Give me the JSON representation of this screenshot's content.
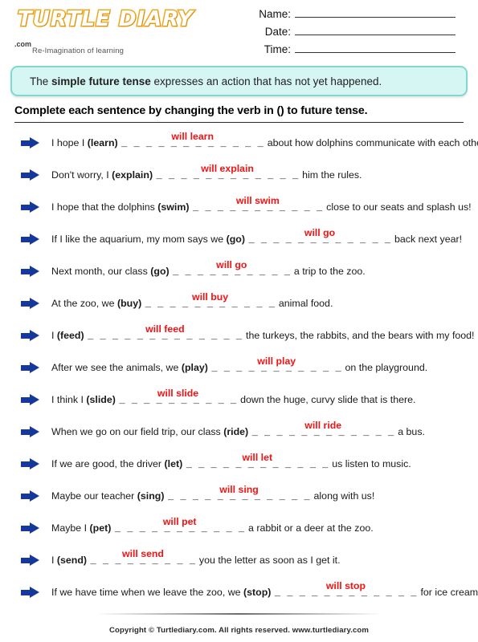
{
  "header": {
    "logo": {
      "word": "TURTLE DIARY",
      "dotcom": ".com",
      "tagline": "Re-Imagination of learning"
    },
    "fields": [
      {
        "label": "Name:"
      },
      {
        "label": "Date:"
      },
      {
        "label": "Time:"
      }
    ]
  },
  "info": {
    "prefix": "The ",
    "bold": "simple future tense",
    "suffix": " expresses an action that has not yet happened."
  },
  "instruction": "Complete each sentence by changing the verb in () to future tense.",
  "questions": [
    {
      "before": "I hope I ",
      "verb": "(learn)",
      "dashes": "_ _ _ _ _ _ _ _ _ _ _ _",
      "answer": "will learn",
      "after": " about how dolphins communicate with each other."
    },
    {
      "before": "Don't worry, I ",
      "verb": "(explain)",
      "dashes": "_ _ _ _ _ _ _ _ _ _ _ _",
      "answer": "will explain",
      "after": " him the rules."
    },
    {
      "before": "I hope that the dolphins ",
      "verb": "(swim)",
      "dashes": "_ _ _ _ _ _ _ _ _ _ _",
      "answer": "will swim",
      "after": " close to our seats and splash us!"
    },
    {
      "before": "If I like the aquarium, my mom says we ",
      "verb": "(go)",
      "dashes": "_ _ _ _ _ _ _ _ _ _ _ _",
      "answer": "will go",
      "after": " back next year!"
    },
    {
      "before": "Next month, our class ",
      "verb": "(go)",
      "dashes": "_ _ _ _ _ _ _ _ _ _",
      "answer": "will go",
      "after": " a trip to the zoo."
    },
    {
      "before": "At the zoo, we ",
      "verb": "(buy)",
      "dashes": "_ _ _ _ _ _ _ _ _ _ _",
      "answer": "will buy",
      "after": " animal food."
    },
    {
      "before": "I ",
      "verb": "(feed)",
      "dashes": "_ _ _ _ _ _ _ _ _ _ _ _ _",
      "answer": "will feed",
      "after": " the turkeys, the rabbits, and the bears with my food!"
    },
    {
      "before": "After we see the animals, we ",
      "verb": "(play)",
      "dashes": "_ _ _ _ _ _ _ _ _ _ _",
      "answer": "will play",
      "after": " on the playground."
    },
    {
      "before": "I think I ",
      "verb": "(slide)",
      "dashes": "_ _ _ _ _ _ _ _ _ _",
      "answer": "will slide",
      "after": " down the huge, curvy slide that is there."
    },
    {
      "before": "When we go on our field trip, our class ",
      "verb": "(ride)",
      "dashes": "_ _ _ _ _ _ _ _ _ _ _ _",
      "answer": "will ride",
      "after": " a bus."
    },
    {
      "before": "If we are good, the driver ",
      "verb": "(let)",
      "dashes": "_ _ _ _ _ _ _ _ _ _ _ _",
      "answer": "will let",
      "after": " us listen to music."
    },
    {
      "before": "Maybe our teacher ",
      "verb": "(sing)",
      "dashes": "_ _ _ _ _ _ _ _ _ _ _ _",
      "answer": "will sing",
      "after": " along with us!"
    },
    {
      "before": "Maybe I ",
      "verb": "(pet)",
      "dashes": "_ _ _ _ _ _ _ _ _ _ _",
      "answer": "will pet",
      "after": " a rabbit or a deer at the zoo."
    },
    {
      "before": "I ",
      "verb": "(send)",
      "dashes": "_ _ _ _ _ _ _ _ _",
      "answer": "will send",
      "after": " you the letter as soon as I get it."
    },
    {
      "before": "If we have time when we leave the zoo, we ",
      "verb": "(stop)",
      "dashes": "_ _ _ _ _ _ _ _ _ _ _ _",
      "answer": "will stop",
      "after": " for ice cream!"
    }
  ],
  "footer": "Copyright © Turtlediary.com. All rights reserved. www.turtlediary.com"
}
